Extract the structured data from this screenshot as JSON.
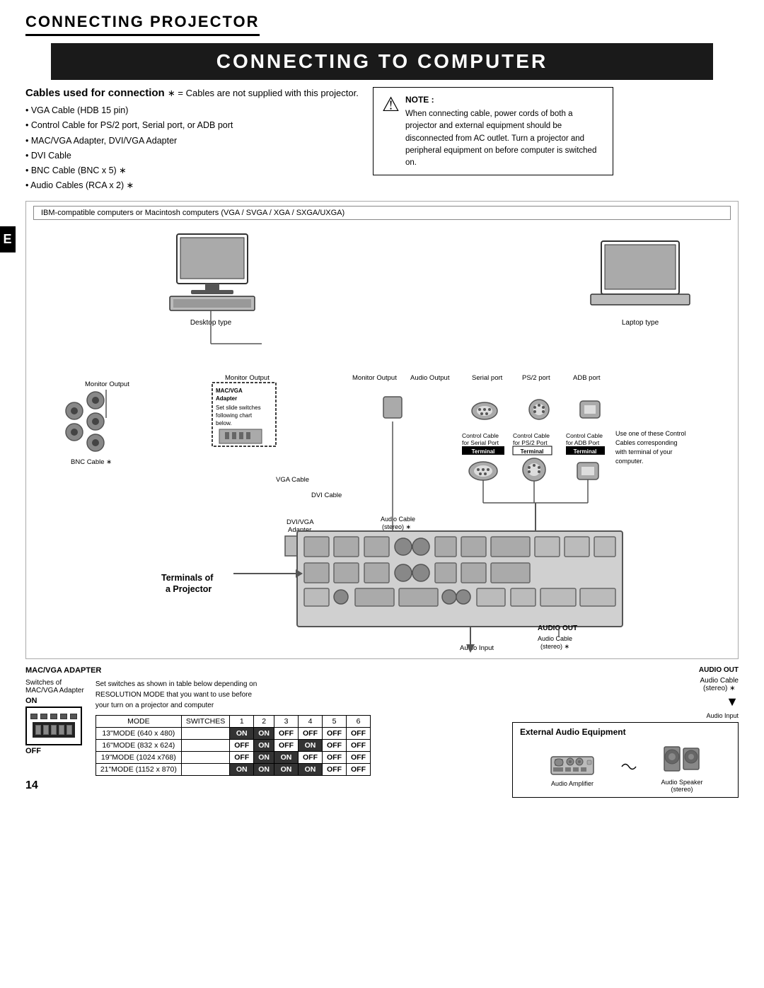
{
  "page": {
    "number": "14"
  },
  "header": {
    "section_title": "CONNECTING PROJECTOR",
    "main_title": "CONNECTING TO COMPUTER"
  },
  "cables": {
    "header": "Cables used for connection",
    "asterisk_note": "∗ = Cables are not supplied with this projector.",
    "items": [
      "• VGA Cable (HDB 15 pin)",
      "• Control Cable for PS/2 port, Serial port, or ADB port",
      "• MAC/VGA Adapter, DVI/VGA Adapter",
      "• DVI Cable",
      "• BNC Cable (BNC x 5) ∗",
      "• Audio Cables (RCA x 2) ∗"
    ]
  },
  "note": {
    "title": "NOTE :",
    "text": "When connecting cable, power cords of both a projector and external equipment should be disconnected from AC outlet. Turn a projector and peripheral equipment on before computer is switched on."
  },
  "ibm_bar": "IBM-compatible computers or Macintosh computers (VGA / SVGA / XGA / SXGA/UXGA)",
  "diagram": {
    "desktop_label": "Desktop type",
    "laptop_label": "Laptop type",
    "labels": {
      "monitor_output_left": "Monitor Output",
      "monitor_output_center": "Monitor Output",
      "monitor_output_right": "Monitor Output",
      "audio_output": "Audio Output",
      "serial_port": "Serial port",
      "ps2_port": "PS/2 port",
      "adb_port": "ADB port",
      "mac_vga_adapter": "MAC/VGA\nAdapter",
      "set_slide": "Set slide switches\nfollowing  chart\nbelow.",
      "bnc_cable": "BNC Cable ∗",
      "vga_cable": "VGA Cable",
      "dvi_cable": "DVI Cable",
      "dvi_vga_adapter": "DVI/VGA\nAdapter",
      "audio_cable_stereo": "Audio Cable\n(stereo) ∗",
      "control_cable_serial": "Control Cable\nfor Serial Port",
      "control_cable_ps2": "Control Cable\nfor PS/2 Port",
      "control_cable_adb": "Control Cable\nfor ADB Port",
      "terminal_serial": "Terminal",
      "terminal_ps2": "Terminal",
      "terminal_adb": "Terminal",
      "use_one_text": "Use one of these Control\nCables corresponding\nwith terminal of your\ncomputer.",
      "terminals_label": "Terminals of\na Projector",
      "audio_out": "AUDIO OUT",
      "audio_cable_out": "Audio Cable\n(stereo) ∗",
      "audio_input": "Audio Input"
    }
  },
  "mac_vga_section": {
    "title": "MAC/VGA ADAPTER",
    "switches_label": "Switches of\nMAC/VGA Adapter",
    "on_label": "ON",
    "off_label": "OFF",
    "table_intro_1": "Set switches as shown in table below depending on",
    "table_intro_2": "RESOLUTION MODE that you want to use before",
    "table_intro_3": "your turn on a projector and computer"
  },
  "resolution_table": {
    "headers": [
      "MODE",
      "SWITCHES",
      "1",
      "2",
      "3",
      "4",
      "5",
      "6"
    ],
    "rows": [
      {
        "mode": "13\"MODE (640 x 480)",
        "s1": "ON",
        "s2": "ON",
        "s3": "OFF",
        "s4": "OFF",
        "s5": "OFF",
        "s6": "OFF"
      },
      {
        "mode": "16\"MODE (832 x 624)",
        "s1": "OFF",
        "s2": "ON",
        "s3": "OFF",
        "s4": "ON",
        "s5": "OFF",
        "s6": "OFF"
      },
      {
        "mode": "19\"MODE (1024 x768)",
        "s1": "OFF",
        "s2": "ON",
        "s3": "ON",
        "s4": "OFF",
        "s5": "OFF",
        "s6": "OFF"
      },
      {
        "mode": "21\"MODE (1152 x 870)",
        "s1": "ON",
        "s2": "ON",
        "s3": "ON",
        "s4": "ON",
        "s5": "OFF",
        "s6": "OFF"
      }
    ]
  },
  "external_audio": {
    "title": "External Audio Equipment",
    "amplifier_label": "Audio Amplifier",
    "speaker_label": "Audio Speaker\n(stereo)"
  },
  "e_tab": "E"
}
